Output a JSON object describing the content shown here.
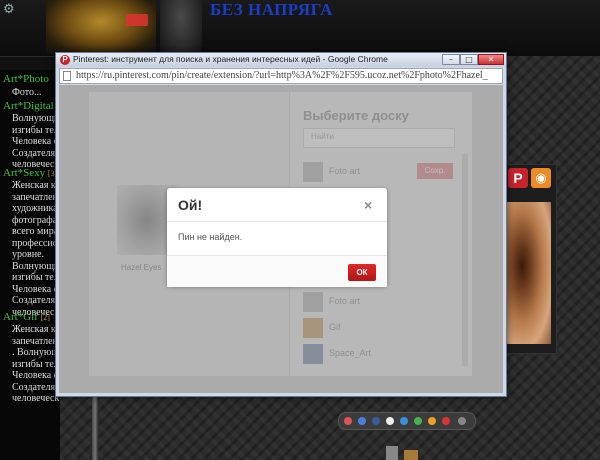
{
  "site": {
    "title": "БЕЗ НАПРЯГА",
    "categories": [
      {
        "name": "Art*Photo",
        "lines": [
          "Фото..."
        ]
      },
      {
        "name": "Art*Digital",
        "lines": [
          "Волнующие",
          "изгибы тела",
          "Человека от",
          "Создателя р",
          "человеческ"
        ]
      },
      {
        "name": "Art*Sexy",
        "count": "[3]",
        "lines": [
          "Женская кр",
          "запечатлен",
          "художника",
          "фотографа",
          "всего мира",
          "профессион",
          "уровне.",
          "Волнующие",
          "изгибы тел",
          "Человека от",
          "Создателя р",
          "человеческ"
        ]
      },
      {
        "name": "Art*Gif",
        "count": "[2]",
        "lines": [
          "Женская кр",
          "запечатлен",
          ". Волнующие",
          "изгибы тел",
          "Человека от",
          "Создателя р",
          "человеческ"
        ]
      }
    ],
    "social": {
      "pinterest": "P",
      "rss": "rss"
    },
    "colors": {
      "category": "#3ec23e",
      "title": "#1b3ec8"
    }
  },
  "window": {
    "title": "Pinterest: инструмент для поиска и хранения интересных идей - Google Chrome",
    "controls": {
      "minimize": "–",
      "maximize": "□",
      "close": "✕"
    },
    "url": "https://ru.pinterest.com/pin/create/extension/?url=http%3A%2F%2F595.ucoz.net%2Fphoto%2Fhazel_"
  },
  "pin_form": {
    "thumb_caption": "Hazel Eyes",
    "heading": "Выберите доску",
    "search_placeholder": "Найти",
    "boards": [
      {
        "name": "Foto art",
        "save": "Сохр."
      },
      {
        "name": "Foto art"
      },
      {
        "name": "Gif"
      },
      {
        "name": "Space_Art"
      }
    ]
  },
  "dialog": {
    "title": "Ой!",
    "close": "×",
    "message": "Пин не найден.",
    "ok_label": "ОК",
    "accent": "#c81e1e"
  }
}
